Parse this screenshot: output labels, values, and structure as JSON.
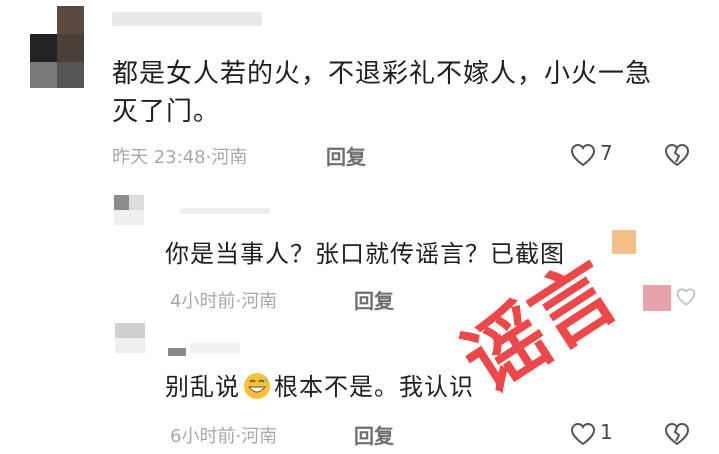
{
  "comment1": {
    "text": "都是女人若的火，不退彩礼不嫁人，小火一急灭了门。",
    "time": "昨天 23:48",
    "location": "河南",
    "reply_label": "回复",
    "likes": "7"
  },
  "reply1": {
    "text": "你是当事人？张口就传谣言？已截图",
    "time": "4小时前",
    "location": "河南",
    "reply_label": "回复"
  },
  "reply2": {
    "text_before": "别乱说",
    "text_after": "根本不是。我认识",
    "time": "6小时前",
    "location": "河南",
    "reply_label": "回复",
    "likes": "1"
  },
  "stamp": {
    "text": "谣言",
    "color": "#ea3a3a"
  },
  "icons": [
    "heart-icon",
    "broken-heart-icon",
    "grinning-sweat-emoji"
  ]
}
